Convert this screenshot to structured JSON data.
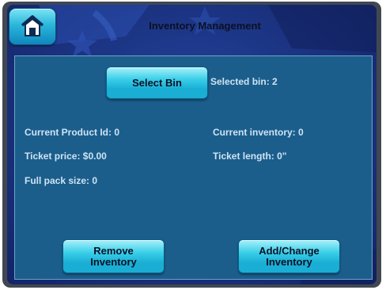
{
  "header": {
    "title": "Inventory Management",
    "home_icon": "home-icon"
  },
  "bin": {
    "select_label": "Select Bin",
    "selected_text": "Selected bin: 2"
  },
  "details": {
    "product_id": "Current Product Id: 0",
    "current_inventory": "Current inventory: 0",
    "ticket_price": "Ticket price: $0.00",
    "ticket_length": "Ticket length: 0\"",
    "full_pack_size": "Full pack size: 0"
  },
  "actions": {
    "remove_line1": "Remove",
    "remove_line2": "Inventory",
    "add_line1": "Add/Change",
    "add_line2": "Inventory"
  },
  "colors": {
    "panel": "#1b5e8c",
    "button": "#2cc3e3",
    "background": "#1d3788",
    "label_text": "#cfe3f3"
  }
}
